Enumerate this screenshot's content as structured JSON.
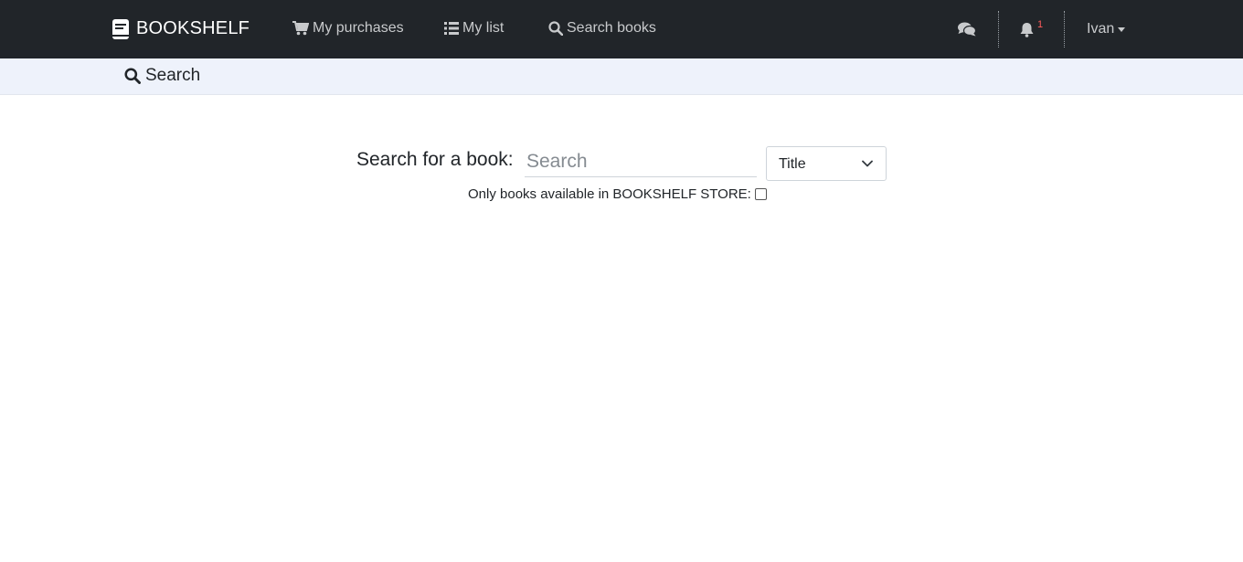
{
  "navbar": {
    "brand": "BOOKSHELF",
    "links": {
      "purchases": "My purchases",
      "list": "My list",
      "search": "Search books"
    },
    "notification_count": "1",
    "user_name": "Ivan",
    "colors": {
      "background": "#212529",
      "badge": "#ff5a5a"
    }
  },
  "subheader": {
    "title": "Search"
  },
  "search": {
    "label": "Search for a book:",
    "placeholder": "Search",
    "value": "",
    "filter_selected": "Title",
    "store_filter_label": "Only books available in BOOKSHELF STORE:",
    "store_filter_checked": false
  },
  "icons": {
    "brand": "book-icon",
    "purchases": "shopping-cart-icon",
    "list": "list-icon",
    "search": "search-icon",
    "chat": "comments-icon",
    "notifications": "bell-icon",
    "dropdown": "chevron-down-icon"
  }
}
